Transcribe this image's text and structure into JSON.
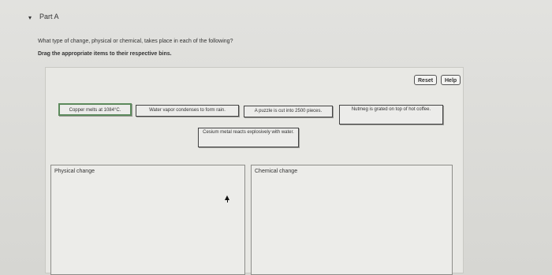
{
  "part": {
    "toggle_icon": "▾",
    "title": "Part A"
  },
  "question": "What type of change, physical or chemical, takes place in each of the following?",
  "instruction": "Drag the appropriate items to their respective bins.",
  "buttons": {
    "reset": "Reset",
    "help": "Help"
  },
  "items": [
    "Copper melts at 1084°C.",
    "Water vapor condenses to form rain.",
    "A puzzle is cut into 2500 pieces.",
    "Nutmeg is grated on top of hot coffee.",
    "Cesium metal reacts explosively with water."
  ],
  "bins": {
    "physical": "Physical change",
    "chemical": "Chemical change"
  }
}
